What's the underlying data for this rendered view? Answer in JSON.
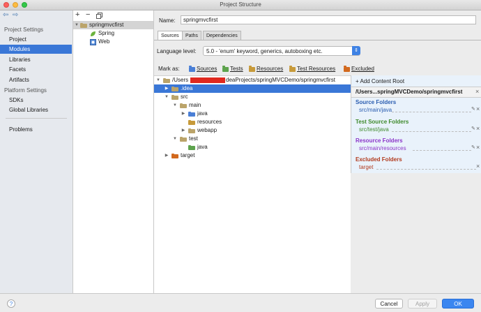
{
  "window": {
    "title": "Project Structure"
  },
  "sidebar": {
    "back_glyph": "⇦",
    "forward_glyph": "⇨",
    "sections": [
      {
        "title": "Project Settings",
        "items": [
          "Project",
          "Modules",
          "Libraries",
          "Facets",
          "Artifacts"
        ]
      },
      {
        "title": "Platform Settings",
        "items": [
          "SDKs",
          "Global Libraries"
        ]
      }
    ],
    "extra_item": "Problems",
    "selected": "Modules"
  },
  "module_panel": {
    "toolbar": {
      "add": "+",
      "remove": "−",
      "copy_icon": "copy-icon"
    },
    "tree": [
      {
        "label": "springmvcfirst",
        "icon": "folder-icon",
        "selected": true
      },
      {
        "label": "Spring",
        "icon": "spring-leaf-icon"
      },
      {
        "label": "Web",
        "icon": "web-module-icon"
      }
    ]
  },
  "details": {
    "name_label": "Name:",
    "name_value": "springmvcfirst",
    "tabs": [
      "Sources",
      "Paths",
      "Dependencies"
    ],
    "active_tab": "Sources",
    "language_level_label": "Language level:",
    "language_level_value": "5.0 - 'enum' keyword, generics, autoboxing etc.",
    "mark_as_label": "Mark as:",
    "mark_as": [
      {
        "label": "Sources",
        "color": "#4a7fd6"
      },
      {
        "label": "Tests",
        "color": "#5da34d"
      },
      {
        "label": "Resources",
        "color": "#c79a3a"
      },
      {
        "label": "Test Resources",
        "color": "#c79a3a"
      },
      {
        "label": "Excluded",
        "color": "#d2691e"
      }
    ]
  },
  "content_tree": {
    "root_prefix": "/Users",
    "root_suffix": "deaProjects/springMVCDemo/springmvcfirst",
    "rows": [
      {
        "label": ".idea",
        "depth": 1,
        "arrow": "▶",
        "selected": true,
        "color": "#bba46a"
      },
      {
        "label": "src",
        "depth": 1,
        "arrow": "▼",
        "color": "#bba46a"
      },
      {
        "label": "main",
        "depth": 2,
        "arrow": "▼",
        "color": "#bba46a"
      },
      {
        "label": "java",
        "depth": 3,
        "arrow": "▶",
        "color": "#4a7fd6"
      },
      {
        "label": "resources",
        "depth": 3,
        "arrow": "",
        "color": "#c79a3a"
      },
      {
        "label": "webapp",
        "depth": 3,
        "arrow": "▶",
        "color": "#bba46a"
      },
      {
        "label": "test",
        "depth": 2,
        "arrow": "▼",
        "color": "#bba46a"
      },
      {
        "label": "java",
        "depth": 3,
        "arrow": "",
        "color": "#5da34d"
      },
      {
        "label": "target",
        "depth": 1,
        "arrow": "▶",
        "color": "#d2691e"
      }
    ]
  },
  "content_roots": {
    "add_label": "+ Add Content Root",
    "root_path": "/Users...springMVCDemo/springmvcfirst",
    "groups": [
      {
        "title": "Source Folders",
        "value": "src/main/java",
        "color": "#2a5db0"
      },
      {
        "title": "Test Source Folders",
        "value": "src/test/java",
        "color": "#3f8a2c"
      },
      {
        "title": "Resource Folders",
        "value": "src/main/resources",
        "color": "#8b35c9"
      },
      {
        "title": "Excluded Folders",
        "value": "target",
        "color": "#b23b1e"
      }
    ]
  },
  "footer": {
    "help": "?",
    "cancel": "Cancel",
    "apply": "Apply",
    "ok": "OK"
  }
}
